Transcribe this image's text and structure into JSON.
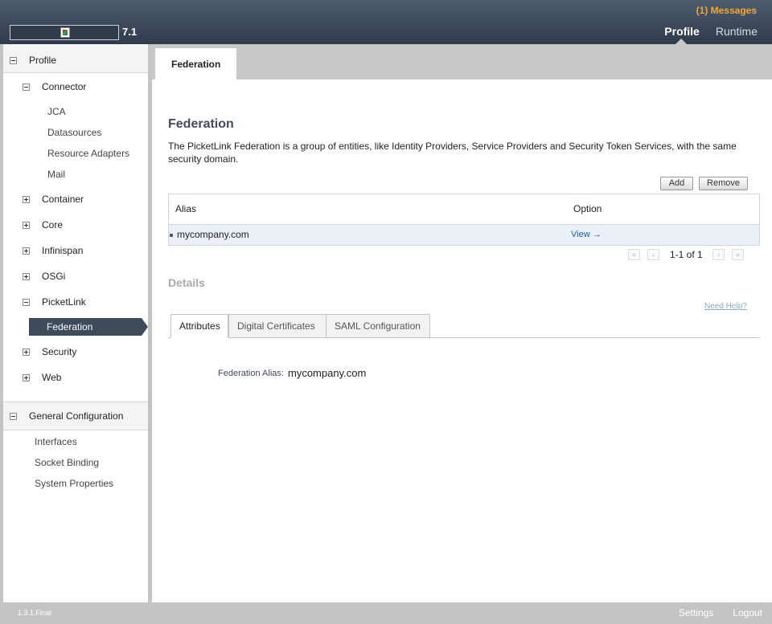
{
  "header": {
    "version": "7.1",
    "messages": "(1) Messages",
    "nav": {
      "profile": "Profile",
      "runtime": "Runtime"
    }
  },
  "sidebar": {
    "profile_section": "Profile",
    "groups": {
      "connector": "Connector",
      "connector_items": [
        "JCA",
        "Datasources",
        "Resource Adapters",
        "Mail"
      ],
      "container": "Container",
      "core": "Core",
      "infinispan": "Infinispan",
      "osgi": "OSGi",
      "picketlink": "PicketLink",
      "picketlink_selected": "Federation",
      "security": "Security",
      "web": "Web"
    },
    "general_section": "General Configuration",
    "general_items": [
      "Interfaces",
      "Socket Binding",
      "System Properties"
    ]
  },
  "main": {
    "tab": "Federation",
    "title": "Federation",
    "description": "The PicketLink Federation is a group of entities, like Identity Providers, Service Providers and Security Token Services, with the same security domain.",
    "buttons": {
      "add": "Add",
      "remove": "Remove"
    },
    "table": {
      "columns": [
        "Alias",
        "Option"
      ],
      "rows": [
        {
          "alias": "mycompany.com",
          "option": "View →"
        }
      ]
    },
    "pager": {
      "text": "1-1 of 1"
    },
    "details": {
      "title": "Details",
      "help": "Need Help?",
      "tabs": [
        "Attributes",
        "Digital Certificates",
        "SAML Configuration"
      ],
      "field_label": "Federation Alias:",
      "field_value": "mycompany.com"
    }
  },
  "footer": {
    "version": "1.3.1.Final",
    "settings": "Settings",
    "logout": "Logout"
  },
  "colors": {
    "header": "#2f3a4b",
    "accent": "#f0a830",
    "selected": "#3f4a5b",
    "link": "#2a5a8a"
  }
}
